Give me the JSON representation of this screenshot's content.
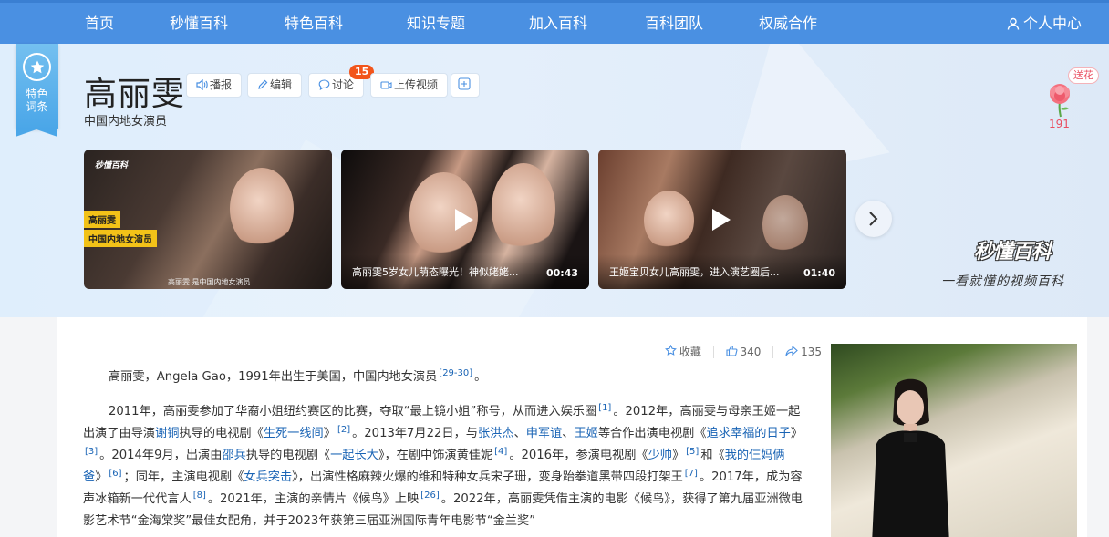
{
  "nav": {
    "items": [
      "首页",
      "秒懂百科",
      "特色百科",
      "知识专题",
      "加入百科",
      "百科团队",
      "权威合作"
    ],
    "user": "个人中心"
  },
  "ribbon": {
    "text_line1": "特色",
    "text_line2": "词条"
  },
  "entry": {
    "title": "高丽雯",
    "subtitle": "中国内地女演员"
  },
  "toolbar": {
    "broadcast": "播报",
    "edit": "编辑",
    "discuss": "讨论",
    "discuss_count": "15",
    "upload_video": "上传视频",
    "add_symbol": "+"
  },
  "flower": {
    "tag": "送花",
    "count": "191"
  },
  "videos": [
    {
      "title": "",
      "duration": "",
      "label1": "高丽雯",
      "label2": "中国内地女演员",
      "logo": "秒懂百科",
      "caption": "高丽雯 是中国内地女演员"
    },
    {
      "title": "高丽雯5岁女儿萌态曝光！神似姥姥...",
      "duration": "00:43"
    },
    {
      "title": "王姬宝贝女儿高丽雯，进入演艺圈后...",
      "duration": "01:40"
    }
  ],
  "brand": {
    "logo": "秒懂百科",
    "slogan": "一看就懂的视频百科"
  },
  "article_actions": {
    "favorite": "收藏",
    "likes": "340",
    "shares": "135"
  },
  "paragraphs": {
    "p1": {
      "t1": "高丽雯，Angela Gao，1991年出生于美国，中国内地女演员",
      "ref1": "[29-30]",
      "t2": "。"
    },
    "p2": {
      "s1": "2011年，高丽雯参加了华裔小姐纽约赛区的比赛，夺取“最上镜小姐”称号，从而进入娱乐圈",
      "r1": "[1]",
      "s2": "。2012年，高丽雯与母亲王姬一起出演了由导演",
      "l1": "谢铜",
      "s3": "执导的电视剧《",
      "l2": "生死一线间",
      "s4": "》",
      "r2": "[2]",
      "s5": "。2013年7月22日，与",
      "l3": "张洪杰",
      "s6": "、",
      "l4": "申军谊",
      "s7": "、",
      "l5": "王姬",
      "s8": "等合作出演电视剧《",
      "l6": "追求幸福的日子",
      "s9": "》",
      "r3": "[3]",
      "s10": "。2014年9月，出演由",
      "l7": "邵兵",
      "s11": "执导的电视剧《",
      "l8": "一起长大",
      "s12": "》，在剧中饰演黄佳妮",
      "r4": "[4]",
      "s13": "。2016年，参演电视剧《",
      "l9": "少帅",
      "s14": "》",
      "r5": "[5]",
      "s15": "和《",
      "l10": "我的仨妈俩爸",
      "s16": "》",
      "r6": "[6]",
      "s17": "；同年，主演电视剧《",
      "l11": "女兵突击",
      "s18": "》，出演性格麻辣火爆的维和特种女兵宋子珊，变身跆拳道黑带四段打架王",
      "r7": "[7]",
      "s19": "。2017年，成为容声冰箱新一代代言人",
      "r8": "[8]",
      "s20": "。2021年，主演的亲情片《候鸟》上映",
      "r9": "[26]",
      "s21": "。2022年，高丽雯凭借主演的电影《候鸟》，获得了第九届亚洲微电影艺术节“金海棠奖”最佳女配角，并于2023年获第三届亚洲国际青年电影节“金兰奖”"
    }
  },
  "colors": {
    "nav": "#4a90e2",
    "link": "#1a64b5",
    "badge": "#f2551b",
    "flower": "#e94e60"
  }
}
